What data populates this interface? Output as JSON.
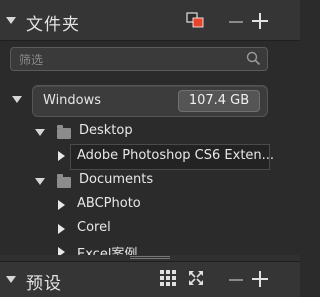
{
  "panel": {
    "title": "文件夹",
    "search_placeholder": "筛选"
  },
  "tree": {
    "root": {
      "label": "Windows",
      "size": "107.4 GB"
    },
    "items": [
      {
        "label": "Desktop",
        "type": "folder",
        "expanded": true
      },
      {
        "label": "Adobe Photoshop CS6 Exten...",
        "type": "item",
        "selected": true
      },
      {
        "label": "Documents",
        "type": "folder",
        "expanded": true
      },
      {
        "label": "ABCPhoto",
        "type": "item"
      },
      {
        "label": "Corel",
        "type": "item"
      },
      {
        "label": "Excel案例",
        "type": "item"
      }
    ]
  },
  "footer": {
    "title": "预设"
  },
  "colors": {
    "accent": "#e8432b",
    "background": "#2b2b2b",
    "header": "#353535"
  },
  "icons": [
    "panel-toggle-icon",
    "new-window-icon",
    "minus-icon",
    "plus-icon",
    "search-icon",
    "folder-icon",
    "grid-view-icon",
    "expand-icon"
  ]
}
